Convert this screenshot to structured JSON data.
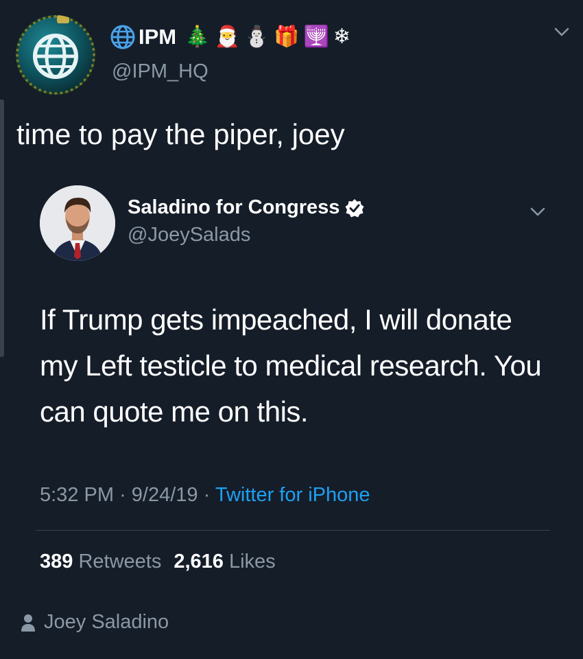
{
  "tweet": {
    "display_name": "IPM",
    "name_emojis": [
      {
        "name": "christmas-tree-icon",
        "glyph": "🎄"
      },
      {
        "name": "santa-icon",
        "glyph": "🎅"
      },
      {
        "name": "snowman-icon",
        "glyph": "⛄"
      },
      {
        "name": "gift-icon",
        "glyph": "🎁"
      },
      {
        "name": "menorah-icon",
        "glyph": "🕎"
      },
      {
        "name": "snowflake-icon",
        "glyph": "❄"
      }
    ],
    "handle": "@IPM_HQ",
    "text": "time to pay the piper, joey"
  },
  "quoted": {
    "display_name": "Saladino for Congress",
    "handle": "@JoeySalads",
    "text": "If Trump gets impeached, I will donate my Left testicle to medical research. You can quote me on this.",
    "time": "5:32 PM",
    "date": "9/24/19",
    "separator": "·",
    "source": "Twitter for iPhone",
    "retweets_count": "389",
    "retweets_label": "Retweets",
    "likes_count": "2,616",
    "likes_label": "Likes"
  },
  "footer": {
    "label": "Joey Saladino"
  },
  "colors": {
    "background": "#151d29",
    "secondary_text": "#8b98a5",
    "link": "#1da1f2",
    "divider": "#38444d"
  }
}
